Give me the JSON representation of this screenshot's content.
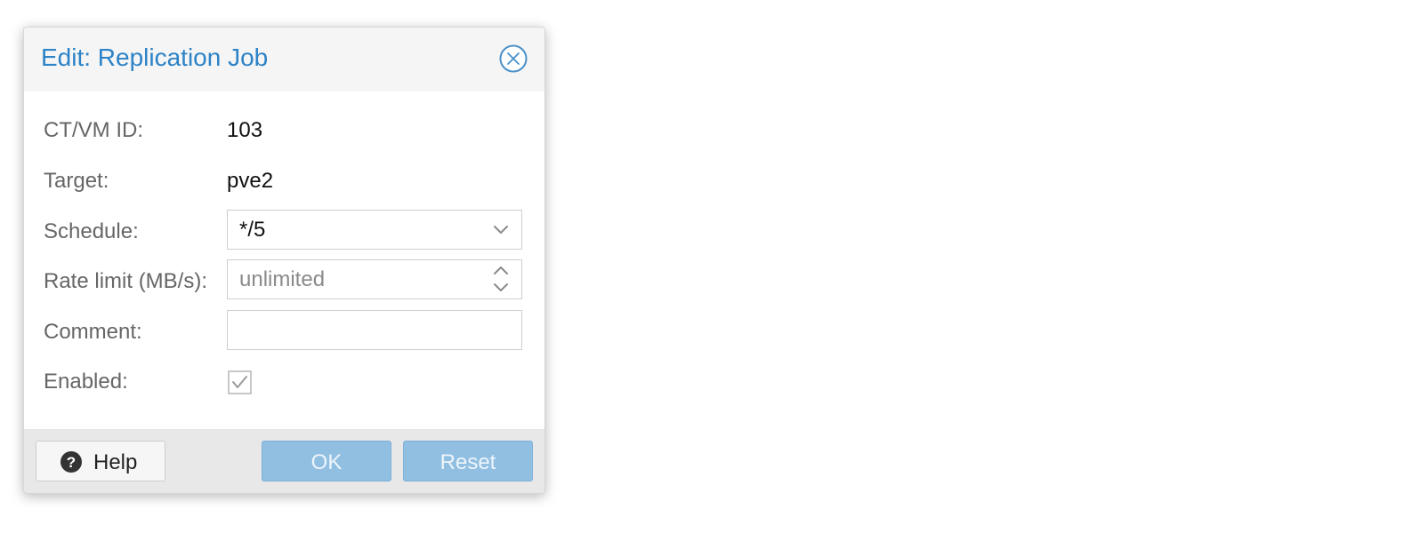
{
  "dialog": {
    "title": "Edit: Replication Job",
    "close_icon": "close-circle-icon"
  },
  "form": {
    "ctvm_id": {
      "label": "CT/VM ID:",
      "value": "103"
    },
    "target": {
      "label": "Target:",
      "value": "pve2"
    },
    "schedule": {
      "label": "Schedule:",
      "value": "*/5"
    },
    "rate_limit": {
      "label": "Rate limit (MB/s):",
      "placeholder": "unlimited"
    },
    "comment": {
      "label": "Comment:",
      "value": ""
    },
    "enabled": {
      "label": "Enabled:",
      "checked": true
    }
  },
  "toolbar": {
    "help_label": "Help",
    "ok_label": "OK",
    "reset_label": "Reset"
  },
  "colors": {
    "title": "#2d83c7",
    "primary_button_disabled": "#91bfe2",
    "header_bg": "#f5f5f5",
    "toolbar_bg": "#e8e8e8"
  }
}
